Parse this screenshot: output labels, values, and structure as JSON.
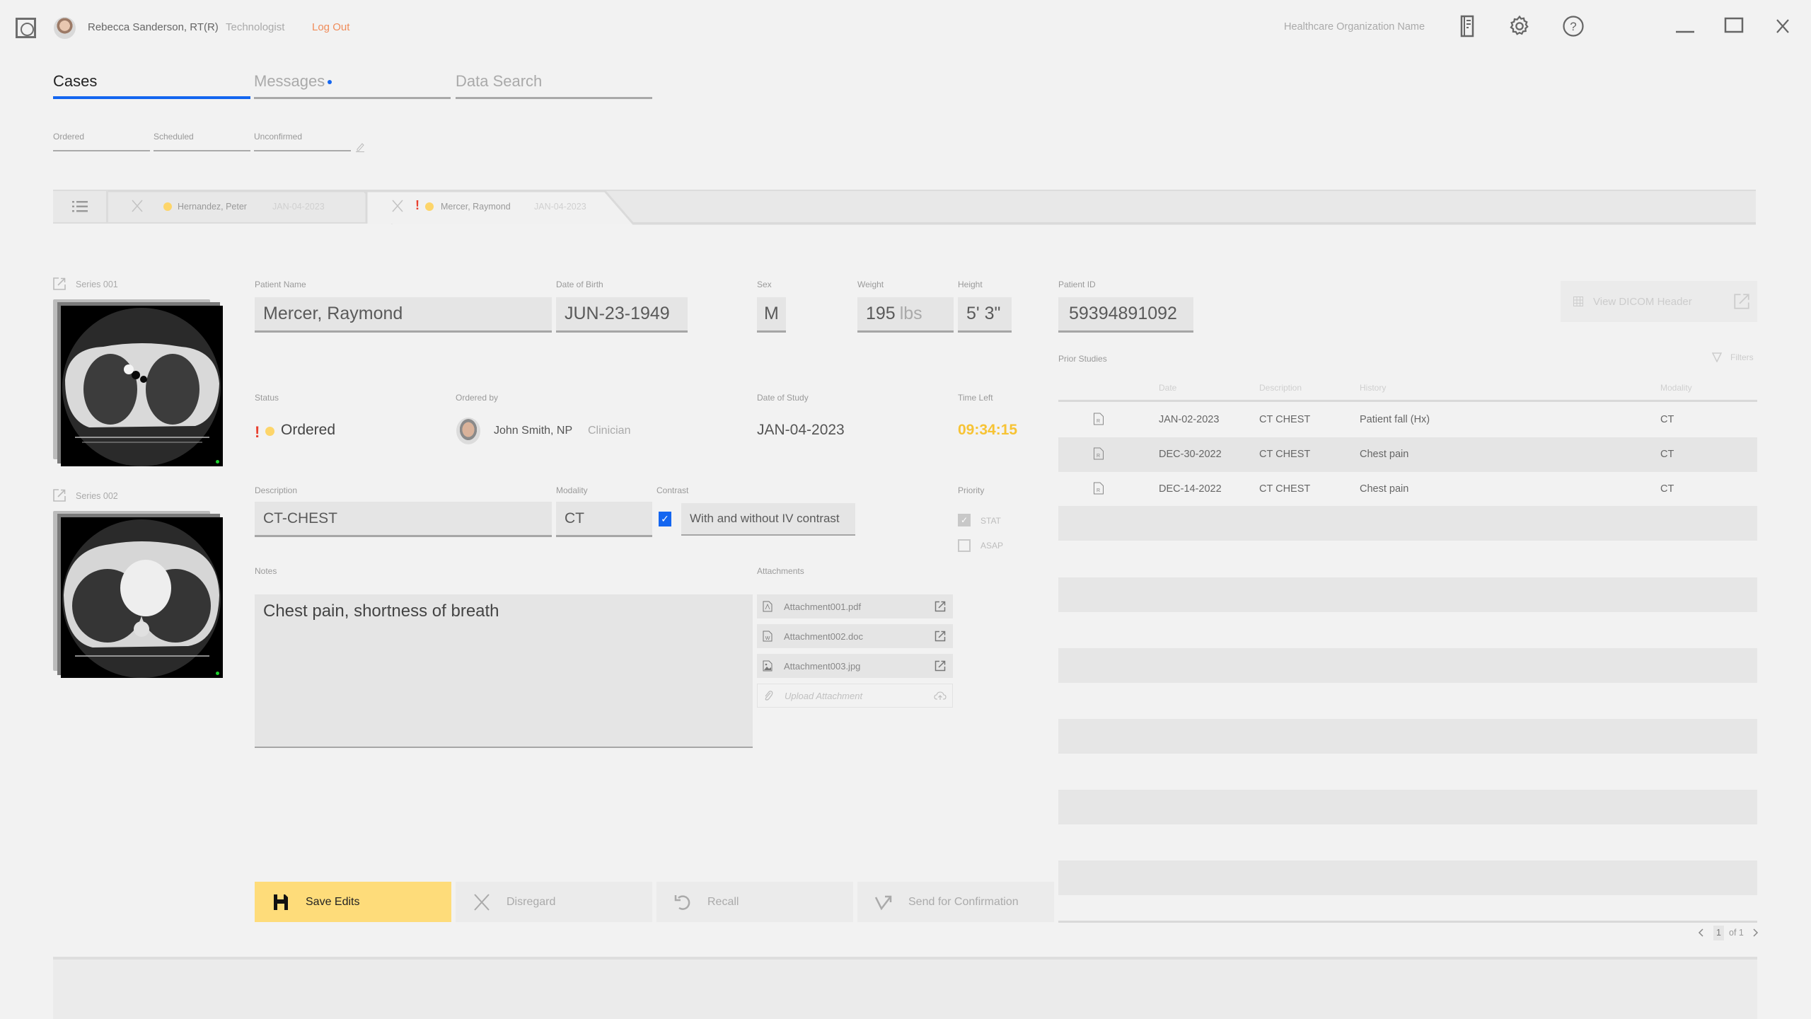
{
  "header": {
    "user_name": "Rebecca Sanderson, RT(R)",
    "user_role": "Technologist",
    "logout_label": "Log Out",
    "org_name": "Healthcare Organization Name",
    "icons": [
      "app-logo",
      "worklist-icon",
      "gear-icon",
      "help-icon"
    ],
    "window_controls": [
      "minimize",
      "maximize",
      "close"
    ]
  },
  "main_tabs": [
    {
      "label": "Cases",
      "active": true
    },
    {
      "label": "Messages",
      "active": false,
      "has_notification_dot": true
    },
    {
      "label": "Data Search",
      "active": false
    }
  ],
  "sub_tabs": [
    {
      "label": "Ordered"
    },
    {
      "label": "Scheduled"
    },
    {
      "label": "Unconfirmed"
    }
  ],
  "case_tabs": [
    {
      "patient": "Hernandez, Peter",
      "date": "JAN-04-2023",
      "urgent": false,
      "active": false
    },
    {
      "patient": "Mercer, Raymond",
      "date": "JAN-04-2023",
      "urgent": true,
      "active": true
    }
  ],
  "series": [
    {
      "label": "Series 001"
    },
    {
      "label": "Series 002"
    }
  ],
  "patient": {
    "name_label": "Patient Name",
    "name": "Mercer, Raymond",
    "dob_label": "Date of Birth",
    "dob": "JUN-23-1949",
    "sex_label": "Sex",
    "sex": "M",
    "weight_label": "Weight",
    "weight": "195",
    "weight_unit": "lbs",
    "height_label": "Height",
    "height": "5' 3\"",
    "id_label": "Patient ID",
    "id": "59394891092"
  },
  "order": {
    "status_label": "Status",
    "status": "Ordered",
    "status_urgent": "!",
    "ordered_by_label": "Ordered by",
    "ordered_by": "John Smith, NP",
    "ordered_by_role": "Clinician",
    "study_date_label": "Date of Study",
    "study_date": "JAN-04-2023",
    "time_left_label": "Time Left",
    "time_left": "09:34:15",
    "description_label": "Description",
    "description": "CT-CHEST",
    "modality_label": "Modality",
    "modality": "CT",
    "contrast_label": "Contrast",
    "contrast_checked": true,
    "contrast": "With and without IV contrast",
    "priority_label": "Priority",
    "priority_options": [
      {
        "label": "STAT",
        "checked": true
      },
      {
        "label": "ASAP",
        "checked": false
      }
    ],
    "notes_label": "Notes",
    "notes": "Chest pain, shortness of breath",
    "attachments_label": "Attachments",
    "attachments": [
      {
        "name": "Attachment001.pdf",
        "type": "pdf"
      },
      {
        "name": "Attachment002.doc",
        "type": "doc"
      },
      {
        "name": "Attachment003.jpg",
        "type": "image"
      }
    ],
    "upload_placeholder": "Upload Attachment"
  },
  "prior_studies": {
    "dicom_button": "View DICOM Header",
    "title": "Prior Studies",
    "filters_label": "Filters",
    "columns": [
      "Date",
      "Description",
      "History",
      "Modality"
    ],
    "rows": [
      {
        "date": "JAN-02-2023",
        "description": "CT CHEST",
        "history": "Patient fall (Hx)",
        "modality": "CT"
      },
      {
        "date": "DEC-30-2022",
        "description": "CT CHEST",
        "history": "Chest pain",
        "modality": "CT"
      },
      {
        "date": "DEC-14-2022",
        "description": "CT CHEST",
        "history": "Chest pain",
        "modality": "CT"
      }
    ],
    "pagination": {
      "current": "1",
      "of_label": "of 1"
    }
  },
  "actions": {
    "save": "Save Edits",
    "disregard": "Disregard",
    "recall": "Recall",
    "send": "Send for Confirmation"
  },
  "colors": {
    "accent": "#1466f0",
    "primary_button": "#fedc7a",
    "warning": "#f7c334",
    "urgent": "#e8402f",
    "logout": "#f08c5a",
    "status_dot": "#fdd56a"
  }
}
